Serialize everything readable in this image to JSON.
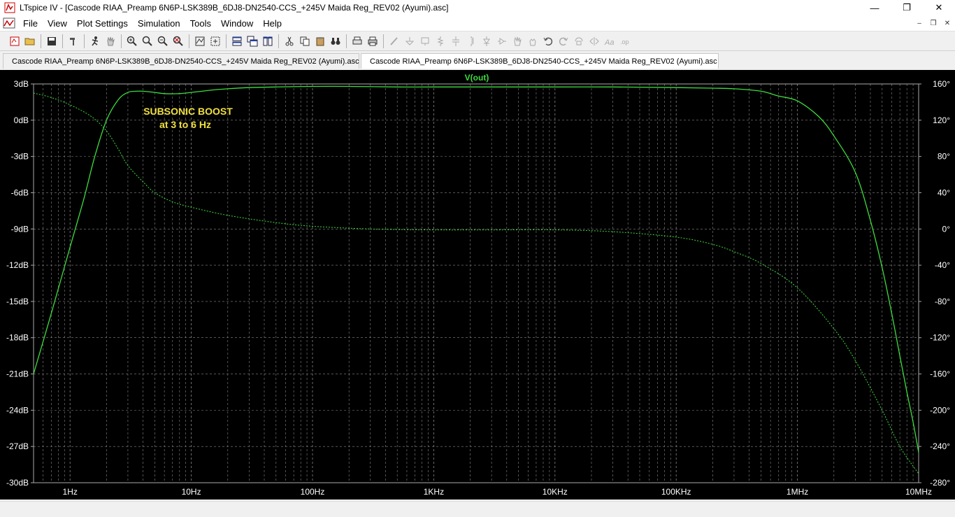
{
  "window": {
    "title": "LTspice IV - [Cascode RIAA_Preamp 6N6P-LSK389B_6DJ8-DN2540-CCS_+245V Maida Reg_REV02 (Ayumi).asc]",
    "minimize": "—",
    "restore": "❐",
    "close": "✕"
  },
  "menu": {
    "items": [
      "File",
      "View",
      "Plot Settings",
      "Simulation",
      "Tools",
      "Window",
      "Help"
    ],
    "mdi_minimize": "–",
    "mdi_restore": "❐",
    "mdi_close": "✕"
  },
  "tabs": [
    {
      "label": "Cascode RIAA_Preamp 6N6P-LSK389B_6DJ8-DN2540-CCS_+245V Maida Reg_REV02 (Ayumi).asc",
      "icon": "schematic-icon",
      "active": false
    },
    {
      "label": "Cascode RIAA_Preamp 6N6P-LSK389B_6DJ8-DN2540-CCS_+245V Maida Reg_REV02 (Ayumi).asc",
      "icon": "waveform-icon",
      "active": true
    }
  ],
  "colors": {
    "trace": "#3ddc3d",
    "grid": "#888888",
    "label": "#ffffff",
    "annotation": "#f0e040",
    "background": "#000000"
  },
  "annotation": {
    "line1": "SUBSONIC BOOST",
    "line2": "at 3 to 6 Hz"
  },
  "chart_data": {
    "type": "line",
    "title": "V(out)",
    "x_scale": "log",
    "xlim": [
      0.5,
      10000000
    ],
    "ylim_left": [
      -30,
      3
    ],
    "ylim_right": [
      -280,
      160
    ],
    "grid": true,
    "x_ticks": [
      {
        "value": 1,
        "label": "1Hz"
      },
      {
        "value": 10,
        "label": "10Hz"
      },
      {
        "value": 100,
        "label": "100Hz"
      },
      {
        "value": 1000,
        "label": "1KHz"
      },
      {
        "value": 10000,
        "label": "10KHz"
      },
      {
        "value": 100000,
        "label": "100KHz"
      },
      {
        "value": 1000000,
        "label": "1MHz"
      },
      {
        "value": 10000000,
        "label": "10MHz"
      }
    ],
    "y_left_ticks": [
      {
        "value": 3,
        "label": "3dB"
      },
      {
        "value": 0,
        "label": "0dB"
      },
      {
        "value": -3,
        "label": "-3dB"
      },
      {
        "value": -6,
        "label": "-6dB"
      },
      {
        "value": -9,
        "label": "-9dB"
      },
      {
        "value": -12,
        "label": "-12dB"
      },
      {
        "value": -15,
        "label": "-15dB"
      },
      {
        "value": -18,
        "label": "-18dB"
      },
      {
        "value": -21,
        "label": "-21dB"
      },
      {
        "value": -24,
        "label": "-24dB"
      },
      {
        "value": -27,
        "label": "-27dB"
      },
      {
        "value": -30,
        "label": "-30dB"
      }
    ],
    "y_right_ticks": [
      {
        "value": 160,
        "label": "160°"
      },
      {
        "value": 120,
        "label": "120°"
      },
      {
        "value": 80,
        "label": "80°"
      },
      {
        "value": 40,
        "label": "40°"
      },
      {
        "value": 0,
        "label": "0°"
      },
      {
        "value": -40,
        "label": "-40°"
      },
      {
        "value": -80,
        "label": "-80°"
      },
      {
        "value": -120,
        "label": "-120°"
      },
      {
        "value": -160,
        "label": "-160°"
      },
      {
        "value": -200,
        "label": "-200°"
      },
      {
        "value": -240,
        "label": "-240°"
      },
      {
        "value": -280,
        "label": "-280°"
      }
    ],
    "series": [
      {
        "name": "V(out)",
        "axis": "left",
        "style": "solid",
        "x": [
          0.5,
          0.7,
          1,
          1.3,
          1.6,
          2,
          2.5,
          3,
          3.5,
          4,
          5,
          6,
          8,
          10,
          15,
          20,
          30,
          50,
          100,
          200,
          500,
          1000,
          3000,
          10000,
          30000,
          100000,
          200000,
          300000,
          500000,
          700000,
          1000000,
          1500000,
          2000000,
          3000000,
          4000000,
          5000000,
          6000000,
          7000000,
          8000000,
          9000000,
          10000000
        ],
        "y": [
          -21,
          -16,
          -10.5,
          -6.5,
          -3,
          0,
          1.7,
          2.3,
          2.4,
          2.4,
          2.3,
          2.2,
          2.2,
          2.3,
          2.5,
          2.6,
          2.7,
          2.75,
          2.8,
          2.8,
          2.75,
          2.75,
          2.75,
          2.75,
          2.75,
          2.7,
          2.65,
          2.6,
          2.4,
          2.0,
          1.6,
          0.3,
          -1.3,
          -4.3,
          -8.3,
          -12.2,
          -16,
          -19.5,
          -22.5,
          -25,
          -27.5
        ]
      },
      {
        "name": "V(out) phase",
        "axis": "right",
        "style": "dashed",
        "x": [
          0.5,
          0.7,
          1,
          1.5,
          2,
          2.5,
          3,
          4,
          5,
          7,
          10,
          20,
          50,
          100,
          300,
          1000,
          3000,
          10000,
          30000,
          100000,
          200000,
          300000,
          500000,
          1000000,
          2000000,
          3000000,
          5000000,
          7000000,
          10000000
        ],
        "y": [
          150,
          145,
          137,
          124,
          108,
          88,
          70,
          52,
          40,
          30,
          24,
          15,
          7,
          3,
          0,
          -1,
          -1,
          -1,
          -3,
          -9,
          -17,
          -25,
          -38,
          -65,
          -110,
          -145,
          -200,
          -240,
          -270
        ]
      }
    ]
  }
}
